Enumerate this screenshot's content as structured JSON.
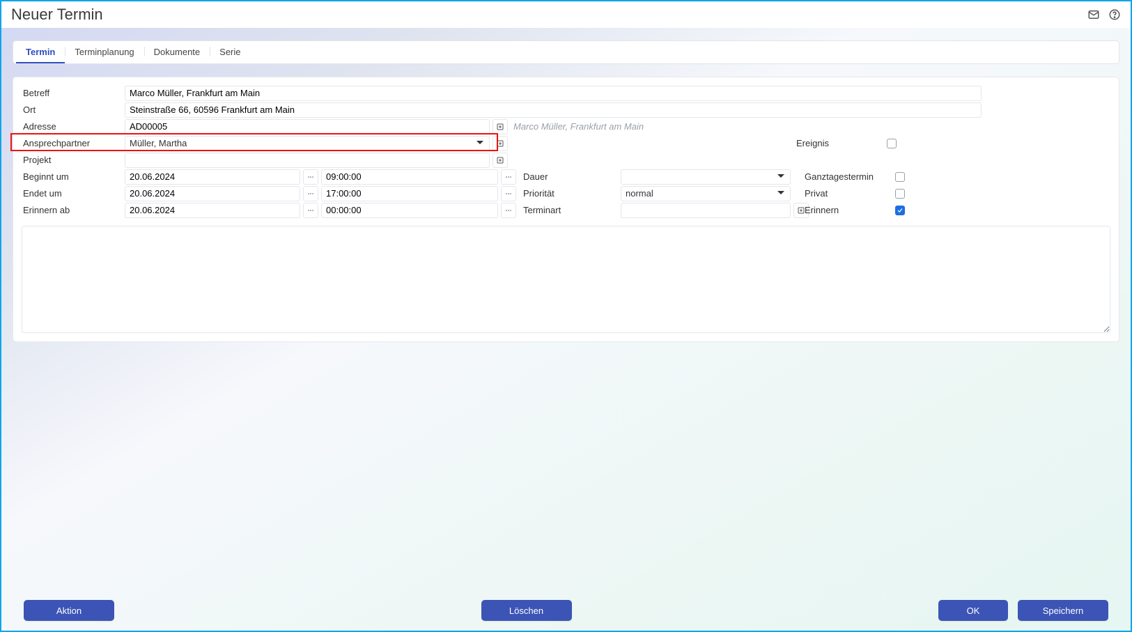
{
  "header": {
    "title": "Neuer Termin"
  },
  "tabs": [
    "Termin",
    "Terminplanung",
    "Dokumente",
    "Serie"
  ],
  "fields": {
    "betreff": {
      "label": "Betreff",
      "value": "Marco Müller, Frankfurt am Main"
    },
    "ort": {
      "label": "Ort",
      "value": "Steinstraße 66, 60596 Frankfurt am Main"
    },
    "adresse": {
      "label": "Adresse",
      "value": "AD00005",
      "hint": "Marco Müller, Frankfurt am Main"
    },
    "ansprechpartner": {
      "label": "Ansprechpartner",
      "value": "Müller, Martha"
    },
    "ereignis": {
      "label": "Ereignis",
      "checked": false
    },
    "projekt": {
      "label": "Projekt",
      "value": ""
    },
    "beginnt": {
      "label": "Beginnt um",
      "date": "20.06.2024",
      "time": "09:00:00"
    },
    "endet": {
      "label": "Endet um",
      "date": "20.06.2024",
      "time": "17:00:00"
    },
    "erinnernAb": {
      "label": "Erinnern ab",
      "date": "20.06.2024",
      "time": "00:00:00"
    },
    "dauer": {
      "label": "Dauer",
      "value": ""
    },
    "ganztag": {
      "label": "Ganztagestermin",
      "checked": false
    },
    "prioritaet": {
      "label": "Priorität",
      "value": "normal"
    },
    "privat": {
      "label": "Privat",
      "checked": false
    },
    "terminart": {
      "label": "Terminart",
      "value": ""
    },
    "erinnern": {
      "label": "Erinnern",
      "checked": true
    }
  },
  "buttons": {
    "aktion": "Aktion",
    "loeschen": "Löschen",
    "ok": "OK",
    "speichern": "Speichern"
  }
}
